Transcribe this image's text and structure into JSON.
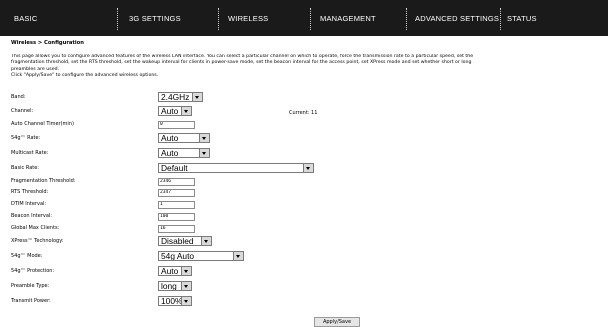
{
  "nav": {
    "basic": "BASIC",
    "g3_settings": "3G SETTINGS",
    "wireless": "WIRELESS",
    "management": "MANAGEMENT",
    "advanced_settings": "ADVANCED SETTINGS",
    "status": "STATUS"
  },
  "breadcrumb": "Wireless > Configuration",
  "description": {
    "line1": "This page allows you to configure advanced features of the wireless LAN interface. You can select a particular channel on which to operate, force the transmission rate to a particular speed, set the",
    "line2": "fragmentation threshold, set the RTS threshold, set the wakeup interval for clients in power-save mode, set the beacon interval for the access point, set XPress mode and set whether short or long",
    "line3": "preambles are used.",
    "line4": "Click \"Apply/Save\" to configure the advanced wireless options."
  },
  "fields": {
    "band": {
      "label": "Band:",
      "value": "2.4GHz"
    },
    "channel": {
      "label": "Channel:",
      "value": "Auto",
      "current": "Current: 11"
    },
    "auto_channel_timer": {
      "label": "Auto Channel Timer(min)",
      "value": "0"
    },
    "rate_54g": {
      "label": "54g™ Rate:",
      "value": "Auto"
    },
    "multicast_rate": {
      "label": "Multicast Rate:",
      "value": "Auto"
    },
    "basic_rate": {
      "label": "Basic Rate:",
      "value": "Default"
    },
    "frag_threshold": {
      "label": "Fragmentation Threshold:",
      "value": "2346"
    },
    "rts_threshold": {
      "label": "RTS Threshold:",
      "value": "2347"
    },
    "dtim_interval": {
      "label": "DTIM Interval:",
      "value": "1"
    },
    "beacon_interval": {
      "label": "Beacon Interval:",
      "value": "100"
    },
    "global_max_clients": {
      "label": "Global Max Clients:",
      "value": "16"
    },
    "xpress_technology": {
      "label": "XPress™ Technology:",
      "value": "Disabled"
    },
    "mode_54g": {
      "label": "54g™ Mode:",
      "value": "54g Auto"
    },
    "protection_54g": {
      "label": "54g™ Protection:",
      "value": "Auto"
    },
    "preamble_type": {
      "label": "Preamble Type:",
      "value": "long"
    },
    "transmit_power": {
      "label": "Transmit Power:",
      "value": "100%"
    }
  },
  "apply_button": "Apply/Save"
}
